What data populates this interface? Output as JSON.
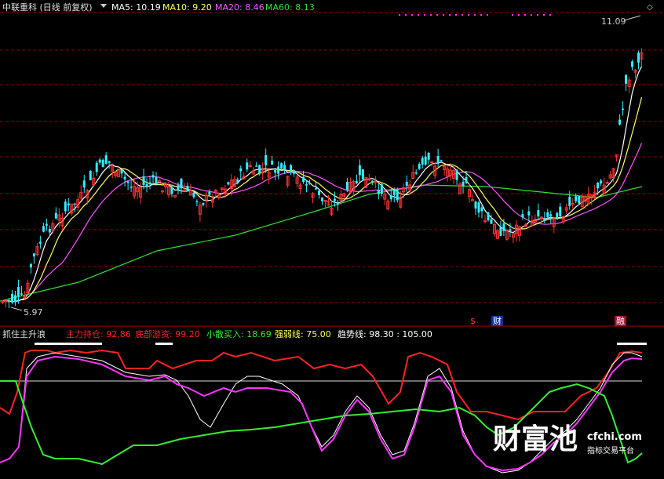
{
  "header": {
    "stock_title": "中联重科 (日线 前复权)",
    "ma5": {
      "label": "MA5:",
      "value": "10.19",
      "color": "#ffffff"
    },
    "ma10": {
      "label": "MA10:",
      "value": "9.20",
      "color": "#ffff66"
    },
    "ma20": {
      "label": "MA20:",
      "value": "8.46",
      "color": "#ff55ff"
    },
    "ma60": {
      "label": "MA60:",
      "value": "8.13",
      "color": "#33dd33"
    }
  },
  "price_panel": {
    "high_label": "11.09",
    "low_label": "5.97",
    "event_markers": [
      "$",
      "财",
      "融"
    ],
    "colors": {
      "up": "#ff3333",
      "down": "#33eeff",
      "grid": "#8b0000"
    }
  },
  "indicator_panel": {
    "title": "抓住主升浪",
    "main_hold": {
      "label": "主力持仓:",
      "value": "92.86",
      "color": "#ff2222"
    },
    "bottom_fund": {
      "label": "底部游资:",
      "value": "99.20",
      "color": "#ff2222"
    },
    "retail_buy": {
      "label": "小散买入:",
      "value": "18.69",
      "color": "#33ee33"
    },
    "strength_line": {
      "label": "强弱线:",
      "value": "75.00",
      "color": "#ffff55"
    },
    "trend_line": {
      "label": "趋势线:",
      "value": "98.30",
      "color": "#ffffff"
    },
    "extra_value": ": 105.00"
  },
  "watermark": {
    "main": "财富池",
    "site": "cfchi.com",
    "sub": "指标交易平台"
  },
  "chart_data": [
    {
      "type": "candlestick",
      "title": "中联重科 (日线 前复权)",
      "x_count": 205,
      "price_range": [
        5.97,
        11.09
      ],
      "series": [
        {
          "name": "MA5",
          "values": [
            10.19
          ]
        },
        {
          "name": "MA10",
          "values": [
            9.2
          ]
        },
        {
          "name": "MA20",
          "values": [
            8.46
          ]
        },
        {
          "name": "MA60",
          "values": [
            8.13
          ]
        }
      ],
      "annotations": [
        "11.09",
        "5.97"
      ]
    },
    {
      "type": "line",
      "title": "抓住主升浪",
      "series": [
        {
          "name": "主力持仓",
          "values": [
            92.86
          ]
        },
        {
          "name": "底部游资",
          "values": [
            99.2
          ]
        },
        {
          "name": "小散买入",
          "values": [
            18.69
          ]
        },
        {
          "name": "强弱线",
          "values": [
            75.0
          ]
        },
        {
          "name": "趋势线",
          "values": [
            98.3
          ]
        }
      ],
      "reference_value": 105.0
    }
  ]
}
